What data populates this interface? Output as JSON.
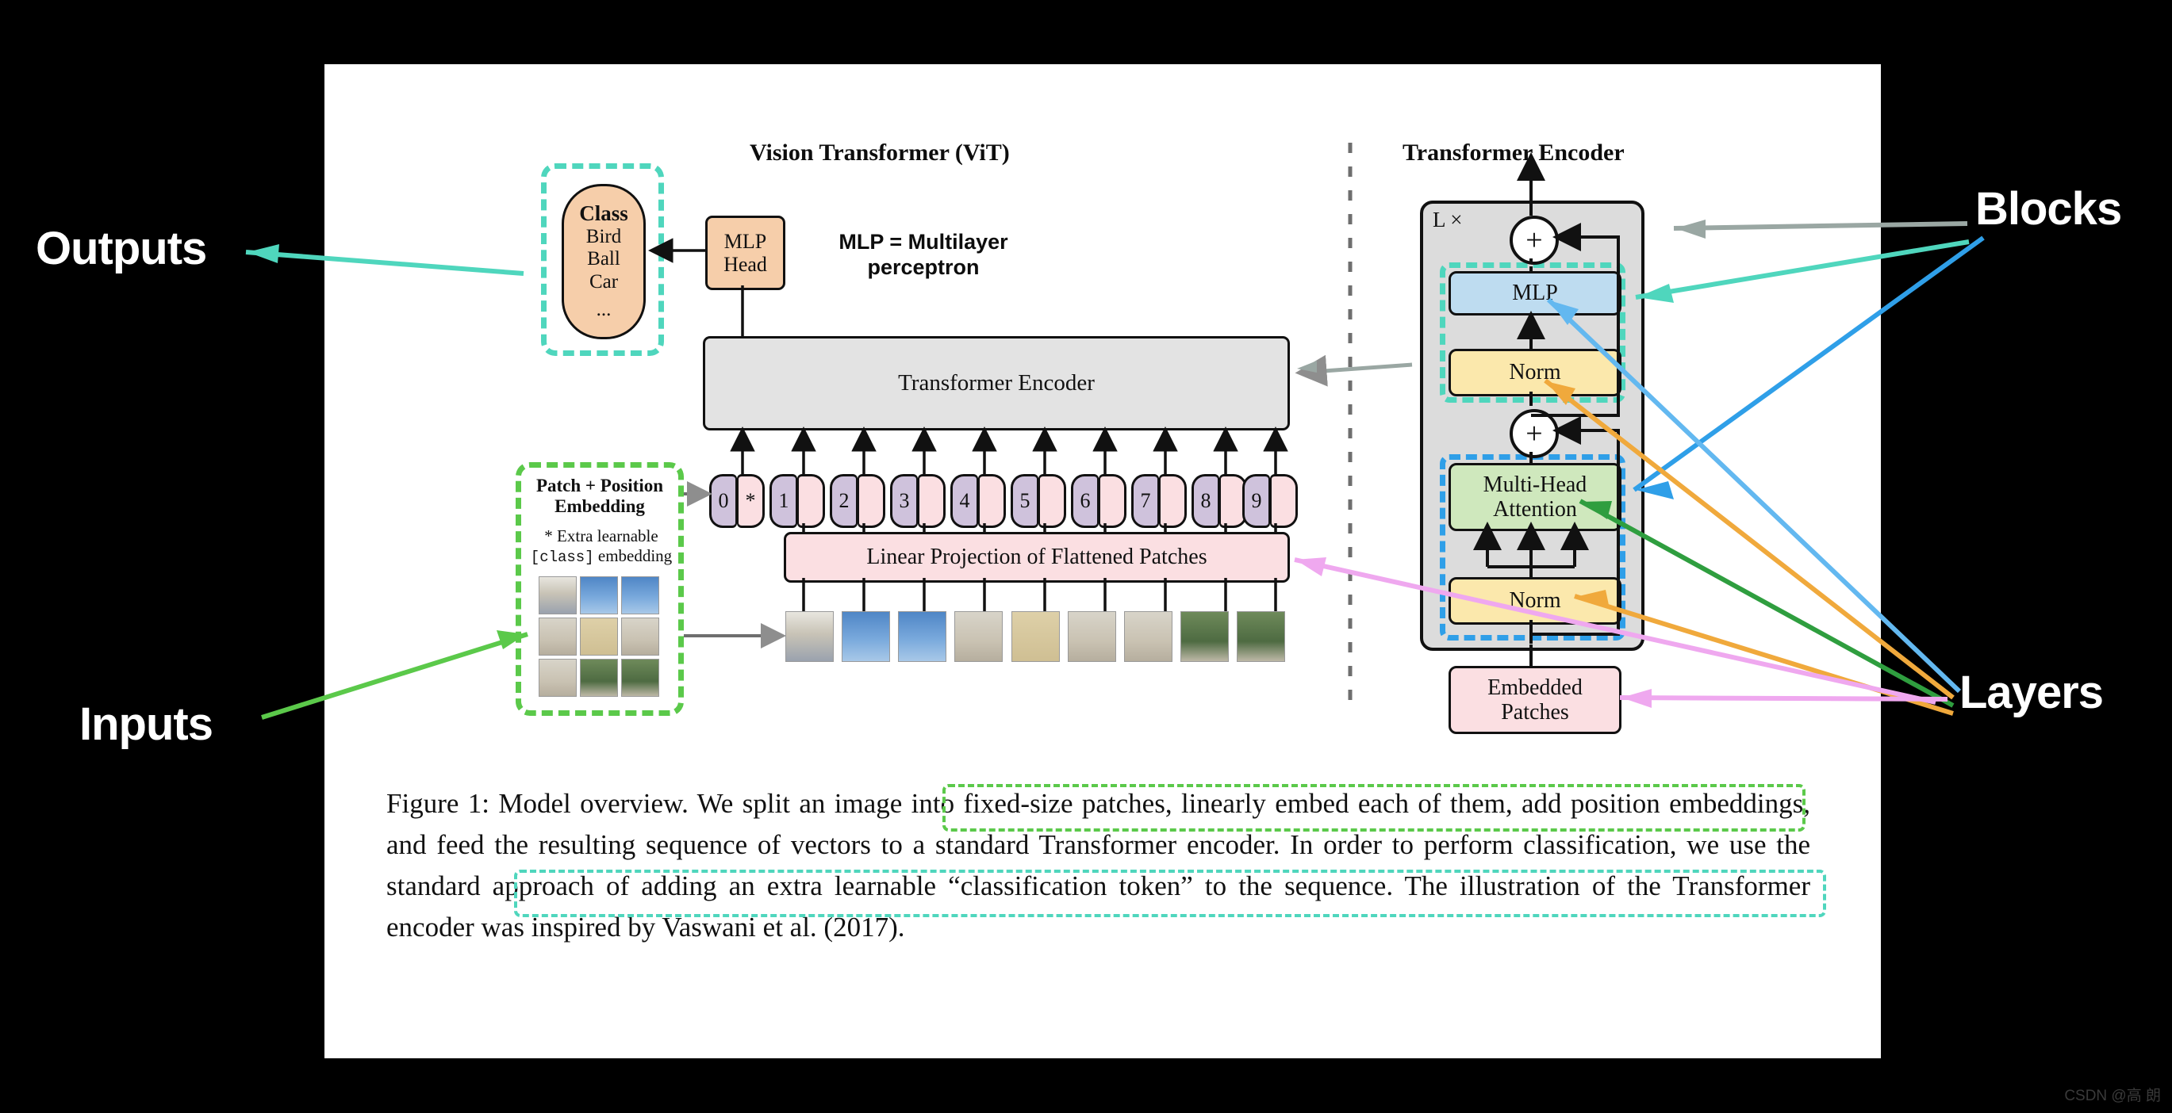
{
  "annotations": {
    "outputs": "Outputs",
    "inputs": "Inputs",
    "blocks": "Blocks",
    "layers": "Layers"
  },
  "watermark": "CSDN @高 朗",
  "vit": {
    "title": "Vision Transformer (ViT)",
    "class_box": {
      "heading": "Class",
      "items": [
        "Bird",
        "Ball",
        "Car"
      ],
      "ellipsis": "..."
    },
    "mlp_head": {
      "line1": "MLP",
      "line2": "Head"
    },
    "mlp_note": "MLP = Multilayer perceptron",
    "transformer_encoder_bar": "Transformer Encoder",
    "linear_projection": "Linear Projection of Flattened Patches",
    "patch_position": {
      "title_line1": "Patch + Position",
      "title_line2": "Embedding",
      "note_line1": "* Extra learnable",
      "note_mono": "[class]",
      "note_line2": " embedding"
    },
    "tokens": [
      {
        "index": "0",
        "extra": "*"
      },
      {
        "index": "1",
        "extra": ""
      },
      {
        "index": "2",
        "extra": ""
      },
      {
        "index": "3",
        "extra": ""
      },
      {
        "index": "4",
        "extra": ""
      },
      {
        "index": "5",
        "extra": ""
      },
      {
        "index": "6",
        "extra": ""
      },
      {
        "index": "7",
        "extra": ""
      },
      {
        "index": "8",
        "extra": ""
      },
      {
        "index": "9",
        "extra": ""
      }
    ],
    "patch_count": 9
  },
  "encoder": {
    "title": "Transformer Encoder",
    "repeat_label": "L ×",
    "plus_symbol": "+",
    "blocks": {
      "mlp": "MLP",
      "norm_top": "Norm",
      "attention_line1": "Multi-Head",
      "attention_line2": "Attention",
      "norm_bottom": "Norm",
      "embedded_line1": "Embedded",
      "embedded_line2": "Patches"
    }
  },
  "caption": {
    "text": "Figure 1: Model overview. We split an image into fixed-size patches, linearly embed each of them, add position embeddings, and feed the resulting sequence of vectors to a standard Transformer encoder. In order to perform classification, we use the standard approach of adding an extra learnable “classification token” to the sequence. The illustration of the Transformer encoder was inspired by Vaswani et al. (2017)."
  },
  "colors": {
    "teal": "#4fd6bd",
    "green": "#5bc94a",
    "blue": "#2f9fe8",
    "orange": "#f0a93c",
    "violet": "#efa8ef",
    "gray": "#9aa7a3",
    "dark_green": "#2f9e3f",
    "class_fill": "#f6ceaa",
    "mlp_fill": "#bedcf0",
    "norm_fill": "#fbe8ac",
    "attn_fill": "#cfe8bd",
    "embed_fill": "#fbdfe2",
    "encoder_fill": "#dcdcdc",
    "token_pos": "#cfc2dc",
    "token_patch": "#fbdfe2"
  }
}
